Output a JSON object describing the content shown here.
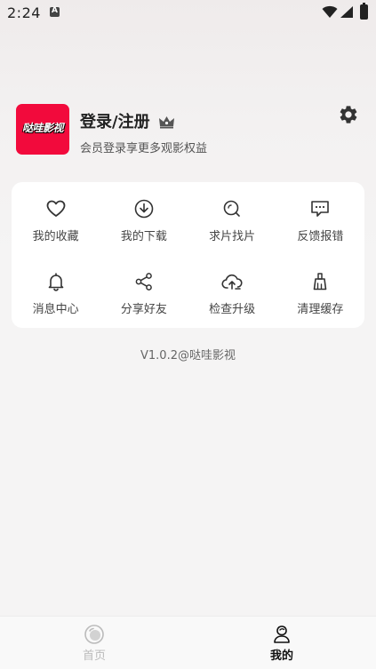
{
  "status_bar": {
    "time": "2:24",
    "icons": [
      "notification-a-icon",
      "wifi-icon",
      "signal-icon",
      "battery-icon"
    ]
  },
  "profile": {
    "logo_text": "哒哇影视",
    "title": "登录/注册",
    "subtitle": "会员登录享更多观影权益",
    "icons": [
      "crown-icon",
      "gear-icon"
    ]
  },
  "menu": {
    "items": [
      {
        "label": "我的收藏",
        "icon": "heart-icon"
      },
      {
        "label": "我的下载",
        "icon": "download-icon"
      },
      {
        "label": "求片找片",
        "icon": "search-icon"
      },
      {
        "label": "反馈报错",
        "icon": "feedback-icon"
      },
      {
        "label": "消息中心",
        "icon": "bell-icon"
      },
      {
        "label": "分享好友",
        "icon": "share-icon"
      },
      {
        "label": "检查升级",
        "icon": "cloud-upload-icon"
      },
      {
        "label": "清理缓存",
        "icon": "brush-icon"
      }
    ]
  },
  "version": "V1.0.2@哒哇影视",
  "bottom_nav": {
    "items": [
      {
        "label": "首页",
        "icon": "home-icon",
        "active": false
      },
      {
        "label": "我的",
        "icon": "profile-icon",
        "active": true
      }
    ]
  },
  "colors": {
    "brand": "#f20a3c",
    "text_primary": "#222222",
    "text_secondary": "#555555",
    "nav_inactive": "#bbbbbb"
  }
}
